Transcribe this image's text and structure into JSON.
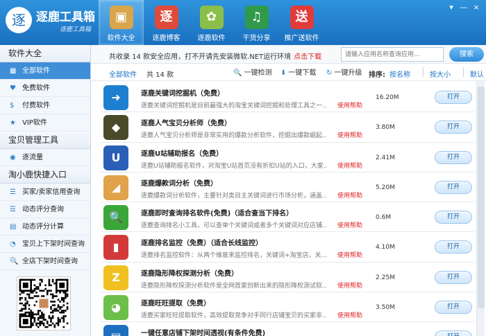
{
  "app": {
    "logo_char": "逐",
    "title": "逐鹿工具箱",
    "subtitle": "逐鹿工具箱"
  },
  "nav": [
    {
      "label": "软件大全",
      "icon": "box-icon",
      "glyph": "▣",
      "color": "#d8a54a"
    },
    {
      "label": "逐鹿博客",
      "icon": "blog-icon",
      "glyph": "逐",
      "color": "#e04a3a"
    },
    {
      "label": "逐鹿软件",
      "icon": "software-icon",
      "glyph": "✿",
      "color": "#8cbf4a"
    },
    {
      "label": "干货分享",
      "icon": "share-icon",
      "glyph": "♫",
      "color": "#2f9a4a"
    },
    {
      "label": "推广送软件",
      "icon": "gift-icon",
      "glyph": "送",
      "color": "#e23b3b"
    }
  ],
  "window": {
    "settings": "▾",
    "minimize": "—",
    "close": "×"
  },
  "sidebar": {
    "section1": "软件大全",
    "section1_items": [
      {
        "label": "全部软件",
        "glyph": "▦"
      },
      {
        "label": "免费软件",
        "glyph": "♥"
      },
      {
        "label": "付费软件",
        "glyph": "$"
      },
      {
        "label": "VIP软件",
        "glyph": "★"
      }
    ],
    "section2": "宝贝管理工具",
    "section2_items": [
      {
        "label": "逐流量",
        "glyph": "◉"
      }
    ],
    "section3": "淘小鹿快捷入口",
    "section3_items": [
      {
        "label": "买家/卖家信用查询",
        "glyph": "☰"
      },
      {
        "label": "动态评分查询",
        "glyph": "☰"
      },
      {
        "label": "动态评分计算",
        "glyph": "▤"
      },
      {
        "label": "宝贝上下架时间查询",
        "glyph": "◔"
      },
      {
        "label": "全店下架时间查询",
        "glyph": "🔍"
      }
    ]
  },
  "info": {
    "text": "共收录 14 款安全应用，打不开请先安装微软.NET运行环境",
    "link": "点击下载",
    "search_placeholder": "请输入应用名称查询应用...",
    "search_button": "搜索"
  },
  "toolbar": {
    "tab_all": "全部软件",
    "total": "共 14 款",
    "detect": "一键检测",
    "download": "一键下载",
    "upgrade": "一键升级",
    "sort_label": "排序:",
    "sort_name": "按名称",
    "sort_size": "按大小",
    "sort_default": "默认"
  },
  "apps": [
    {
      "name": "逐鹿关键词挖掘机（免费）",
      "desc": "逐鹿关键词挖掘机是目前最强大的淘宝关键词挖掘和处理工具之一...",
      "help": "使用帮助",
      "size": "16.20M",
      "open": "打开",
      "icon_color": "#1e7fd0",
      "glyph": "➜"
    },
    {
      "name": "逐鹿人气宝贝分析师（免费）",
      "desc": "逐鹿人气宝贝分析师是非常实用的爆款分析软件，挖掘出爆款崛起...",
      "help": "使用帮助",
      "size": "3.80M",
      "open": "打开",
      "icon_color": "#4a4a2a",
      "glyph": "◆"
    },
    {
      "name": "逐鹿U站辅助报名（免费）",
      "desc": "逐鹿U站辅助报名软件，对淘宝U站首页没有折扣U站的入口，大家...",
      "help": "使用帮助",
      "size": "2.41M",
      "open": "打开",
      "icon_color": "#2a5fb8",
      "glyph": "U"
    },
    {
      "name": "逐鹿爆款词分析（免费）",
      "desc": "逐鹿爆款词分析软件，主要针对类目主关键词进行市场分析，涵盖...",
      "help": "使用帮助",
      "size": "5.20M",
      "open": "打开",
      "icon_color": "#e0a24a",
      "glyph": "◢"
    },
    {
      "name": "逐鹿即时查询排名软件(免费)（适合查当下排名）",
      "desc": "逐鹿查询排名小工具，可以查单个关键词或者多个关键词对应店铺...",
      "help": "使用帮助",
      "size": "0.6M",
      "open": "打开",
      "icon_color": "#3aa63a",
      "glyph": "🔍"
    },
    {
      "name": "逐鹿排名监控（免费）（适合长线监控）",
      "desc": "逐鹿排名监控软件：从两个维度来监控排名，关键词+淘宝店，关...",
      "help": "使用帮助",
      "size": "4.10M",
      "open": "打开",
      "icon_color": "#d23a3a",
      "glyph": "▮"
    },
    {
      "name": "逐鹿隐形降权探测分析（免费）",
      "desc": "逐鹿隐形降权探测分析软件是全网首家创新出来的隐形降权测试软...",
      "help": "使用帮助",
      "size": "2.25M",
      "open": "打开",
      "icon_color": "#f0c020",
      "glyph": "Z"
    },
    {
      "name": "逐鹿旺旺提取（免费）",
      "desc": "逐鹿买家旺旺提取软件，高效提取竞争对手同行店铺宝贝的买家非...",
      "help": "使用帮助",
      "size": "3.50M",
      "open": "打开",
      "icon_color": "#6cbf4a",
      "glyph": "◕"
    },
    {
      "name": "一键任意店铺下架时间透视(有条件免费)",
      "desc": "",
      "help": "",
      "size": "",
      "open": "打开",
      "icon_color": "#1e6fbf",
      "glyph": "▤"
    }
  ]
}
